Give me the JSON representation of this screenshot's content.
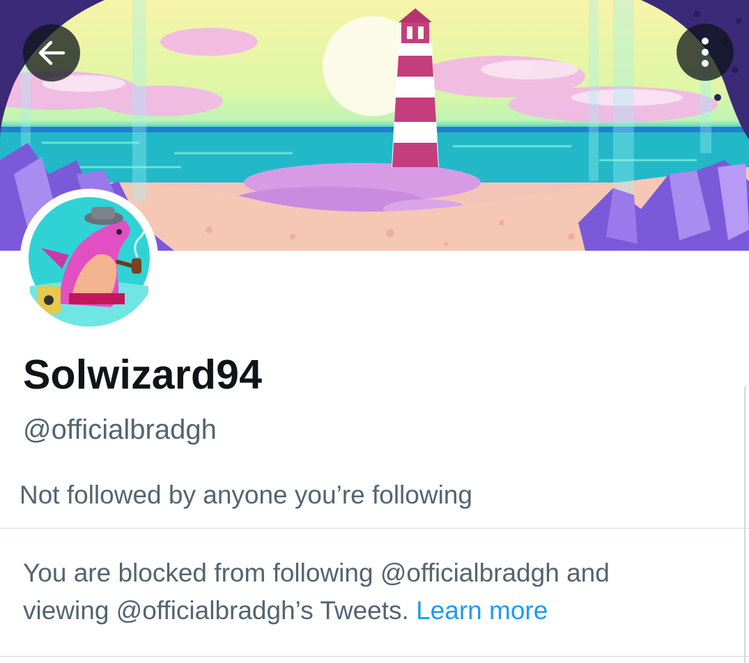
{
  "profile": {
    "display_name": "Solwizard94",
    "handle": "@officialbradgh",
    "followers_context": "Not followed by anyone you’re following"
  },
  "blocked_notice": {
    "line1": "You are blocked from following @officialbradgh and",
    "line2_prefix": "viewing @officialbradgh’s Tweets.",
    "learn_more": "Learn more"
  },
  "icons": {
    "back": "arrow-left-icon",
    "more": "vertical-ellipsis-icon"
  },
  "colors": {
    "text_primary": "#0f1419",
    "text_secondary": "#536471",
    "link": "#1d9bf0",
    "divider": "#cfd9de",
    "button_overlay": "#0f1419"
  }
}
